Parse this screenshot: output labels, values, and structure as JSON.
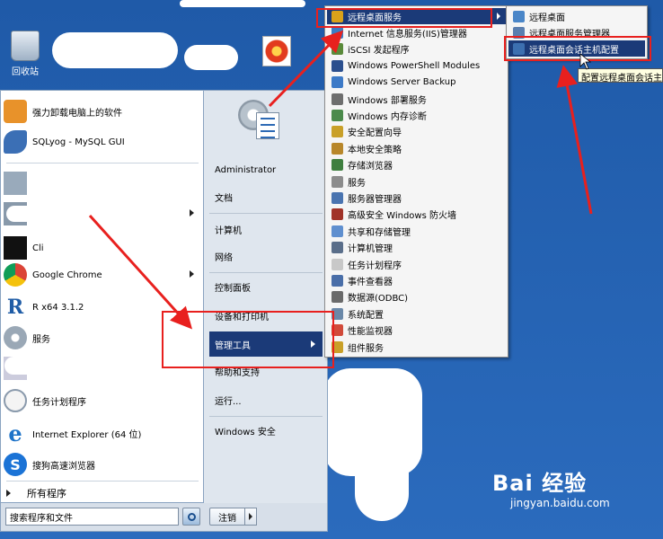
{
  "desktop": {
    "recycle_label": "回收站"
  },
  "start_menu": {
    "pinned": [
      {
        "label": "强力卸载电脑上的软件",
        "icon": "uninstall-icon",
        "has_submenu": false
      },
      {
        "label": "SQLyog - MySQL GUI",
        "icon": "dolphin-icon",
        "has_submenu": false
      }
    ],
    "recent": [
      {
        "label": "",
        "icon": "app-icon",
        "has_submenu": false
      },
      {
        "label": "",
        "icon": "app-icon",
        "has_submenu": true
      },
      {
        "label": "Cli",
        "icon": "terminal-icon",
        "has_submenu": false
      },
      {
        "label": "Google Chrome",
        "icon": "chrome-icon",
        "has_submenu": true
      },
      {
        "label": "R x64 3.1.2",
        "icon": "r-icon",
        "has_submenu": false
      },
      {
        "label": "服务",
        "icon": "services-gear-icon",
        "has_submenu": false
      },
      {
        "label": "",
        "icon": "control-icon",
        "has_submenu": false
      },
      {
        "label": "任务计划程序",
        "icon": "clock-icon",
        "has_submenu": false
      },
      {
        "label": "Internet Explorer (64 位)",
        "icon": "ie-icon",
        "has_submenu": false
      },
      {
        "label": "搜狗高速浏览器",
        "icon": "sogou-icon",
        "has_submenu": false
      }
    ],
    "all_programs": "所有程序",
    "search_placeholder": "搜索程序和文件",
    "logoff_label": "注销",
    "right_pane": {
      "items": [
        {
          "label": "Administrator",
          "active": false
        },
        {
          "label": "文档",
          "active": false
        },
        {
          "label": "计算机",
          "active": false
        },
        {
          "label": "网络",
          "active": false
        },
        {
          "label": "控制面板",
          "active": false
        },
        {
          "label": "设备和打印机",
          "active": false
        },
        {
          "label": "管理工具",
          "active": true
        },
        {
          "label": "帮助和支持",
          "active": false
        },
        {
          "label": "运行...",
          "active": false
        },
        {
          "label": "Windows 安全",
          "active": false
        }
      ]
    }
  },
  "admin_tools_menu": {
    "items": [
      {
        "label": "远程桌面服务",
        "color": "#d9a21a",
        "highlighted": true,
        "has_submenu": true
      },
      {
        "label": "Internet 信息服务(IIS)管理器",
        "color": "#3b7dc4",
        "highlighted": false
      },
      {
        "label": "iSCSI 发起程序",
        "color": "#5a8a3a",
        "highlighted": false
      },
      {
        "label": "Windows PowerShell Modules",
        "color": "#2b4f8e",
        "highlighted": false
      },
      {
        "label": "Windows Server Backup",
        "color": "#3d7ac7",
        "highlighted": false
      },
      {
        "label": "Windows 部署服务",
        "color": "#6e6e6e",
        "highlighted": false
      },
      {
        "label": "Windows 内存诊断",
        "color": "#4b8a4b",
        "highlighted": false
      },
      {
        "label": "安全配置向导",
        "color": "#c9a028",
        "highlighted": false
      },
      {
        "label": "本地安全策略",
        "color": "#b8872a",
        "highlighted": false
      },
      {
        "label": "存储浏览器",
        "color": "#3f7f3f",
        "highlighted": false
      },
      {
        "label": "服务",
        "color": "#8c8c8c",
        "highlighted": false
      },
      {
        "label": "服务器管理器",
        "color": "#4a74b0",
        "highlighted": false
      },
      {
        "label": "高级安全 Windows 防火墙",
        "color": "#a03228",
        "highlighted": false
      },
      {
        "label": "共享和存储管理",
        "color": "#5f8fcf",
        "highlighted": false
      },
      {
        "label": "计算机管理",
        "color": "#5a6e8a",
        "highlighted": false
      },
      {
        "label": "任务计划程序",
        "color": "#c8c8c8",
        "highlighted": false
      },
      {
        "label": "事件查看器",
        "color": "#4a6ea8",
        "highlighted": false
      },
      {
        "label": "数据源(ODBC)",
        "color": "#6a6a6a",
        "highlighted": false
      },
      {
        "label": "系统配置",
        "color": "#6a88a8",
        "highlighted": false
      },
      {
        "label": "性能监视器",
        "color": "#d14a3a",
        "highlighted": false
      },
      {
        "label": "组件服务",
        "color": "#c9a028",
        "highlighted": false
      }
    ]
  },
  "remote_desktop_menu": {
    "items": [
      {
        "label": "远程桌面",
        "color": "#4a86c8",
        "highlighted": false
      },
      {
        "label": "远程桌面服务管理器",
        "color": "#5a7fb0",
        "highlighted": false
      },
      {
        "label": "远程桌面会话主机配置",
        "color": "#3c6fb0",
        "highlighted": true
      }
    ]
  },
  "tooltip": "配置远程桌面会话主",
  "watermark": {
    "brand": "Bai 经验",
    "url": "jingyan.baidu.com"
  },
  "colors": {
    "highlight": "#1b3a78",
    "annotation_red": "#e8201e",
    "desktop_blue": "#2a64b0"
  }
}
